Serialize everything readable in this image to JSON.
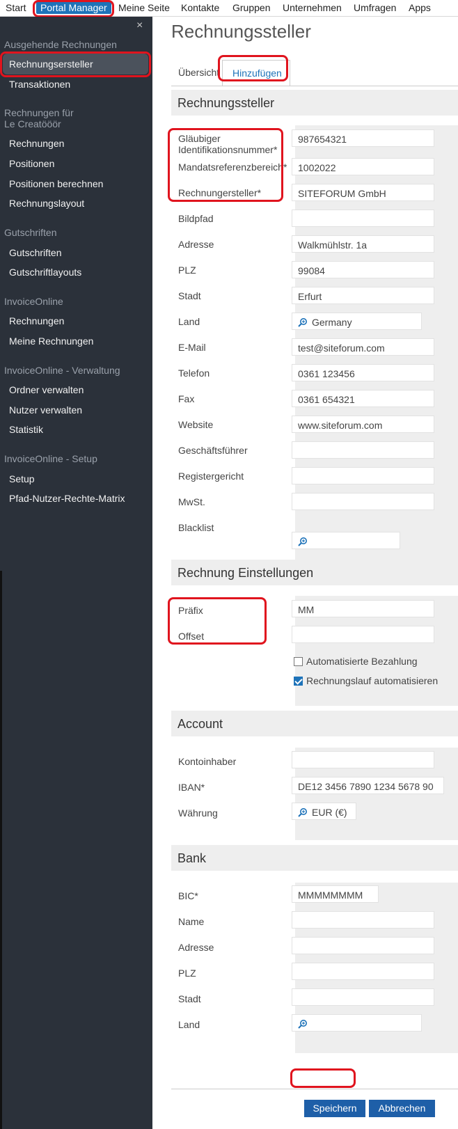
{
  "topnav": {
    "items": [
      "Start",
      "Portal Manager",
      "Meine Seite",
      "Kontakte",
      "Gruppen",
      "Unternehmen",
      "Umfragen",
      "Apps"
    ]
  },
  "sidebar": {
    "close": "×",
    "sections": [
      {
        "heading": "Ausgehende Rechnungen",
        "items": [
          "Rechnungsersteller",
          "Transaktionen"
        ]
      },
      {
        "heading": "Rechnungen für",
        "heading2": "Le Creatööör",
        "items": [
          "Rechnungen",
          "Positionen",
          "Positionen berechnen",
          "Rechnungslayout"
        ]
      },
      {
        "heading": "Gutschriften",
        "items": [
          "Gutschriften",
          "Gutschriftlayouts"
        ]
      },
      {
        "heading": "InvoiceOnline",
        "items": [
          "Rechnungen",
          "Meine Rechnungen"
        ]
      },
      {
        "heading": "InvoiceOnline - Verwaltung",
        "items": [
          "Ordner verwalten",
          "Nutzer verwalten",
          "Statistik"
        ]
      },
      {
        "heading": "InvoiceOnline - Setup",
        "items": [
          "Setup",
          "Pfad-Nutzer-Rechte-Matrix"
        ]
      }
    ]
  },
  "main": {
    "title": "Rechnungssteller",
    "tabs": [
      "Übersicht",
      "Hinzufügen"
    ],
    "section_rechnungssteller": "Rechnungssteller",
    "fields1": [
      {
        "label": "Gläubiger",
        "label2": "Identifikationsnummer*",
        "value": "987654321"
      },
      {
        "label": "Mandatsreferenzbereich*",
        "value": "1002022"
      },
      {
        "label": "Rechnungersteller*",
        "value": "SITEFORUM GmbH"
      },
      {
        "label": "Bildpfad",
        "value": ""
      },
      {
        "label": "Adresse",
        "value": "Walkmühlstr. 1a"
      },
      {
        "label": "PLZ",
        "value": "99084"
      },
      {
        "label": "Stadt",
        "value": "Erfurt"
      },
      {
        "label": "Land",
        "value": "Germany"
      },
      {
        "label": "E-Mail",
        "value": "test@siteforum.com"
      },
      {
        "label": "Telefon",
        "value": "0361 123456"
      },
      {
        "label": "Fax",
        "value": "0361 654321"
      },
      {
        "label": "Website",
        "value": "www.siteforum.com"
      },
      {
        "label": "Geschäftsführer",
        "value": ""
      },
      {
        "label": "Registergericht",
        "value": ""
      },
      {
        "label": "MwSt.",
        "value": ""
      },
      {
        "label": "Blacklist",
        "value": ""
      }
    ],
    "section_einstellungen": "Rechnung Einstellungen",
    "fields2": [
      {
        "label": "Präfix",
        "value": "MM"
      },
      {
        "label": "Offset",
        "value": ""
      }
    ],
    "checkboxes": [
      {
        "label": "Automatisierte Bezahlung",
        "checked": false
      },
      {
        "label": "Rechnungslauf automatisieren",
        "checked": true
      }
    ],
    "section_account": "Account",
    "fields3": [
      {
        "label": "Kontoinhaber",
        "value": ""
      },
      {
        "label": "IBAN*",
        "value": "DE12 3456 7890 1234 5678 90"
      },
      {
        "label": "Währung",
        "value": "EUR (€)"
      }
    ],
    "section_bank": "Bank",
    "fields4": [
      {
        "label": "BIC*",
        "value": "MMMMMMMM"
      },
      {
        "label": "Name",
        "value": ""
      },
      {
        "label": "Adresse",
        "value": ""
      },
      {
        "label": "PLZ",
        "value": ""
      },
      {
        "label": "Stadt",
        "value": ""
      },
      {
        "label": "Land",
        "value": ""
      }
    ],
    "save_label": "Speichern",
    "cancel_label": "Abbrechen"
  },
  "colors": {
    "accent": "#1e73b9",
    "sidebar": "#2b313a",
    "highlight": "#e0141e"
  }
}
